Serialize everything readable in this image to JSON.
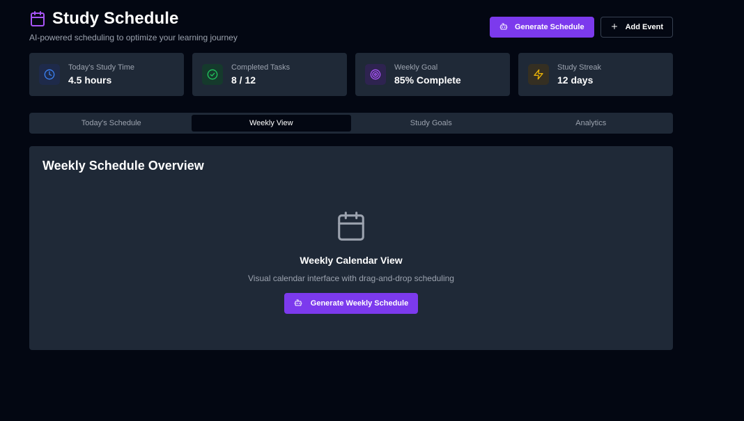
{
  "header": {
    "title": "Study Schedule",
    "subtitle": "AI-powered scheduling to optimize your learning journey",
    "icon": "calendar-icon",
    "generate_label": "Generate Schedule",
    "add_event_label": "Add Event"
  },
  "stats": [
    {
      "label": "Today's Study Time",
      "value": "4.5 hours",
      "icon": "clock-icon",
      "color": "#3b82f6"
    },
    {
      "label": "Completed Tasks",
      "value": "8 / 12",
      "icon": "check-circle-icon",
      "color": "#22c55e"
    },
    {
      "label": "Weekly Goal",
      "value": "85% Complete",
      "icon": "target-icon",
      "color": "#a855f7"
    },
    {
      "label": "Study Streak",
      "value": "12 days",
      "icon": "zap-icon",
      "color": "#eab308"
    }
  ],
  "tabs": [
    {
      "label": "Today's Schedule",
      "active": false
    },
    {
      "label": "Weekly View",
      "active": true
    },
    {
      "label": "Study Goals",
      "active": false
    },
    {
      "label": "Analytics",
      "active": false
    }
  ],
  "panel": {
    "title": "Weekly Schedule Overview",
    "empty_title": "Weekly Calendar View",
    "empty_description": "Visual calendar interface with drag-and-drop scheduling",
    "button_label": "Generate Weekly Schedule"
  },
  "colors": {
    "background": "#030712",
    "card": "#1f2937",
    "accent": "#7c3aed",
    "muted_text": "#9ca3af"
  }
}
